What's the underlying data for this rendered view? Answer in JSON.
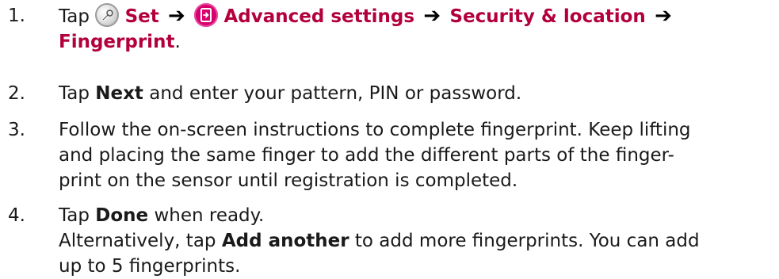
{
  "steps": [
    {
      "number": "1.",
      "tap": "Tap",
      "set": "Set",
      "advanced_settings": "Advanced settings",
      "security_location": "Security & location",
      "fingerprint": "Fingerprint",
      "period": ".",
      "arrow": "➔",
      "icons": [
        "settings-icon",
        "advanced-settings-icon"
      ]
    },
    {
      "number": "2.",
      "tap": "Tap",
      "next": "Next",
      "rest": "and enter your pattern, PIN or password."
    },
    {
      "number": "3.",
      "lines": [
        "Follow the on-screen instructions to complete fingerprint. Keep lifting",
        "and placing the same finger to add the different parts of the finger-",
        "print on the sensor until registration is completed."
      ]
    },
    {
      "number": "4.",
      "tap": "Tap",
      "done": "Done",
      "when_ready": "when ready.",
      "alt_prefix": "Alternatively, tap",
      "add_another": "Add another",
      "alt_suffix": "to add more fingerprints. You can add",
      "last_line": "up to 5 fingerprints."
    }
  ],
  "colors": {
    "highlight": "#b3003c",
    "text": "#1a1a1a",
    "advanced_icon": "#d6006f"
  }
}
